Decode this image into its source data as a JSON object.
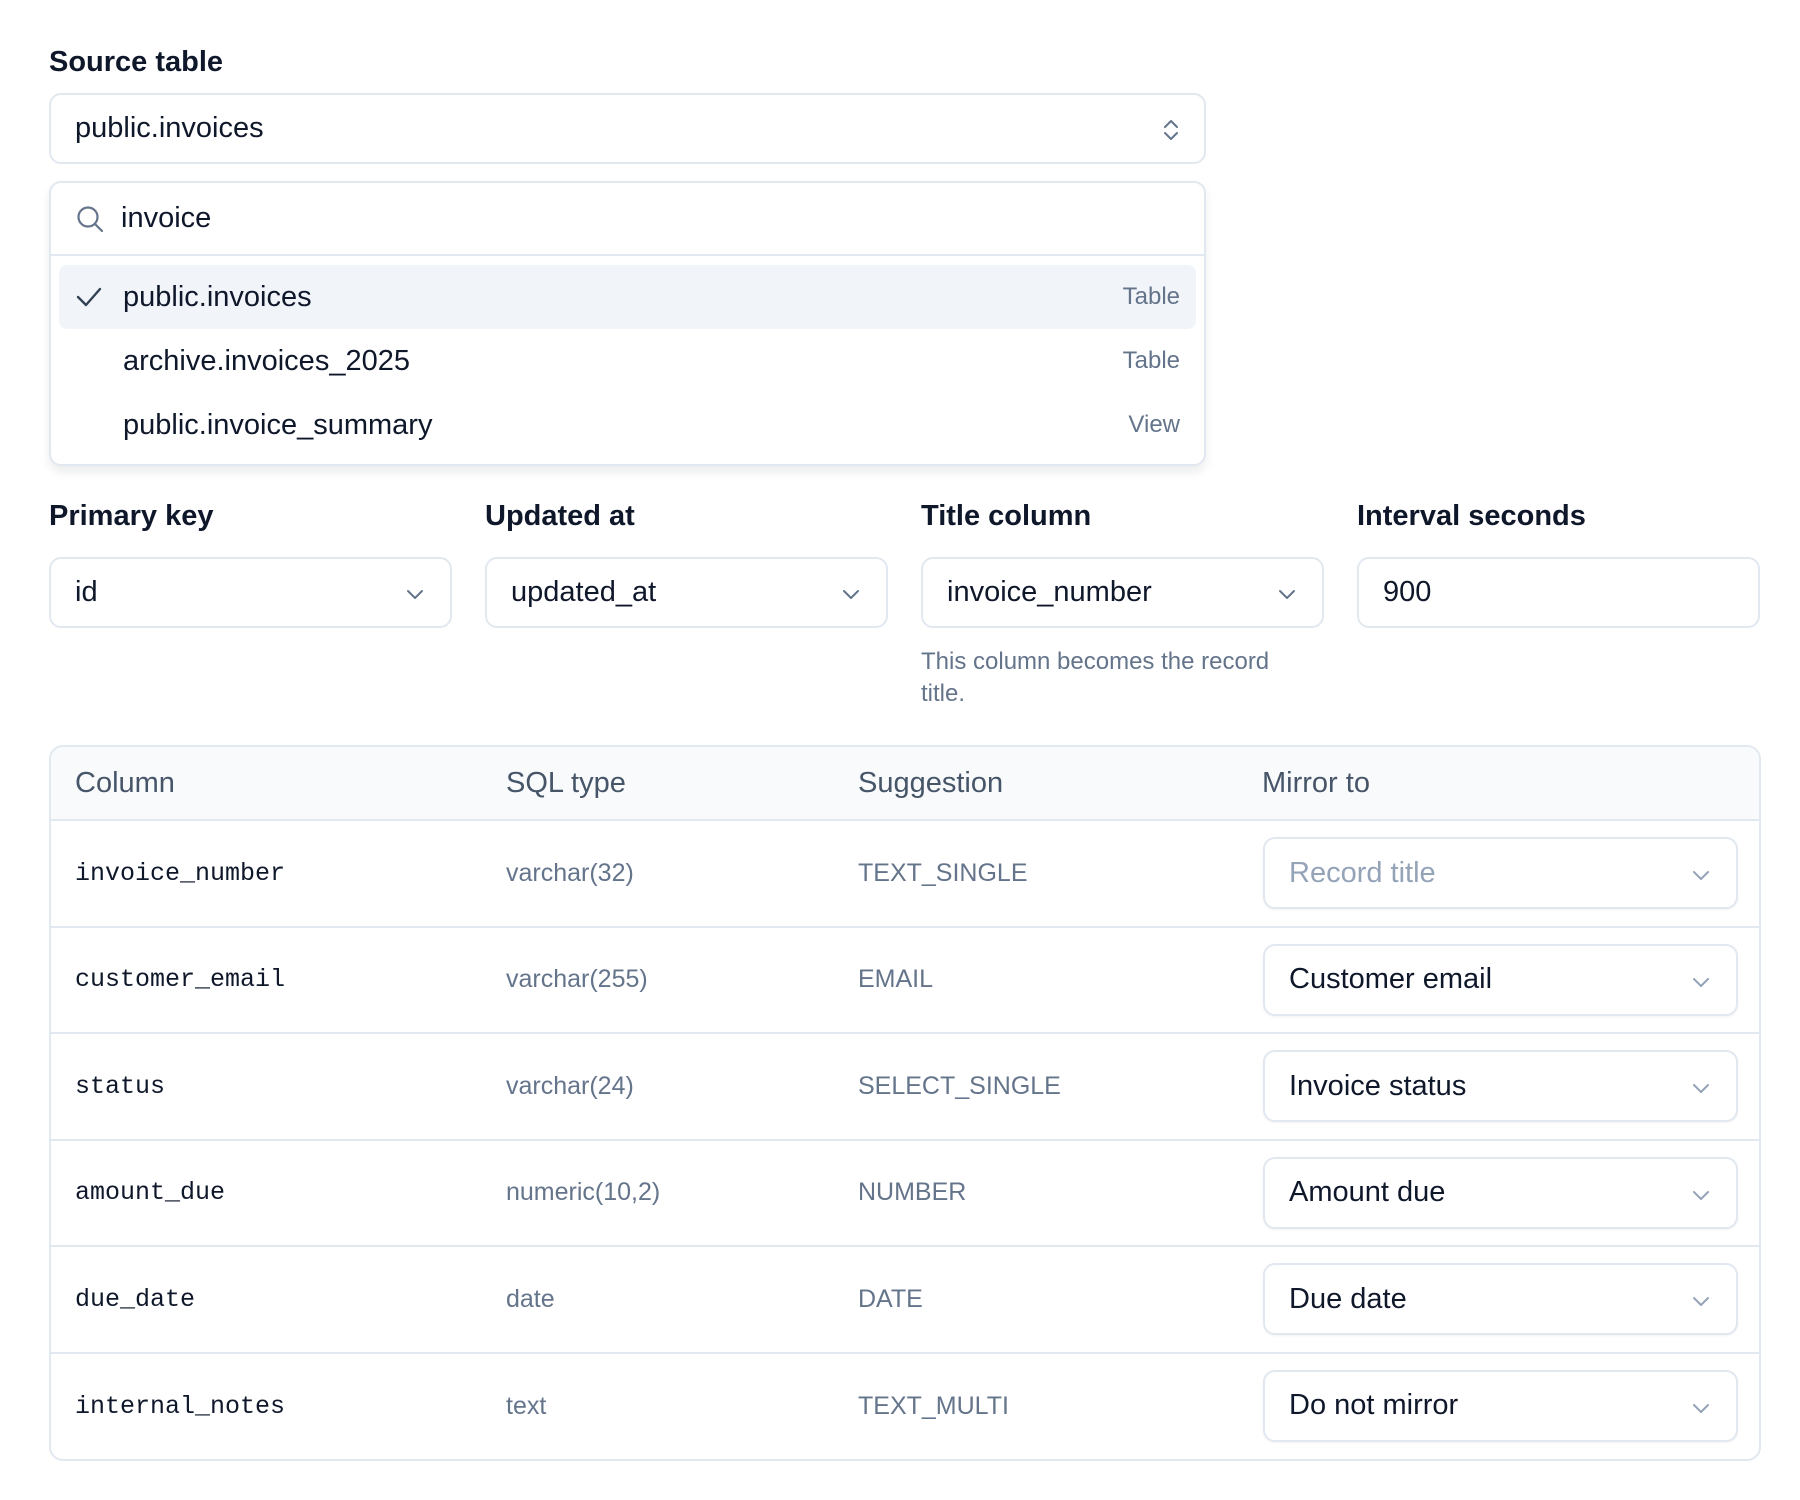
{
  "source": {
    "label": "Source table",
    "value": "public.invoices",
    "search_value": "invoice",
    "options": [
      {
        "name": "public.invoices",
        "kind": "Table",
        "selected": true
      },
      {
        "name": "archive.invoices_2025",
        "kind": "Table",
        "selected": false
      },
      {
        "name": "public.invoice_summary",
        "kind": "View",
        "selected": false
      }
    ]
  },
  "fields": {
    "primary_key": {
      "label": "Primary key",
      "value": "id"
    },
    "updated_at": {
      "label": "Updated at",
      "value": "updated_at"
    },
    "title_column": {
      "label": "Title column",
      "value": "invoice_number",
      "helper": "This column becomes the record title."
    },
    "interval": {
      "label": "Interval seconds",
      "value": "900"
    }
  },
  "table": {
    "headers": [
      "Column",
      "SQL type",
      "Suggestion",
      "Mirror to"
    ],
    "rows": [
      {
        "column": "invoice_number",
        "sql_type": "varchar(32)",
        "suggestion": "TEXT_SINGLE",
        "mirror": "Record title",
        "disabled": true
      },
      {
        "column": "customer_email",
        "sql_type": "varchar(255)",
        "suggestion": "EMAIL",
        "mirror": "Customer email",
        "disabled": false
      },
      {
        "column": "status",
        "sql_type": "varchar(24)",
        "suggestion": "SELECT_SINGLE",
        "mirror": "Invoice status",
        "disabled": false
      },
      {
        "column": "amount_due",
        "sql_type": "numeric(10,2)",
        "suggestion": "NUMBER",
        "mirror": "Amount due",
        "disabled": false
      },
      {
        "column": "due_date",
        "sql_type": "date",
        "suggestion": "DATE",
        "mirror": "Due date",
        "disabled": false
      },
      {
        "column": "internal_notes",
        "sql_type": "text",
        "suggestion": "TEXT_MULTI",
        "mirror": "Do not mirror",
        "disabled": false
      }
    ]
  }
}
